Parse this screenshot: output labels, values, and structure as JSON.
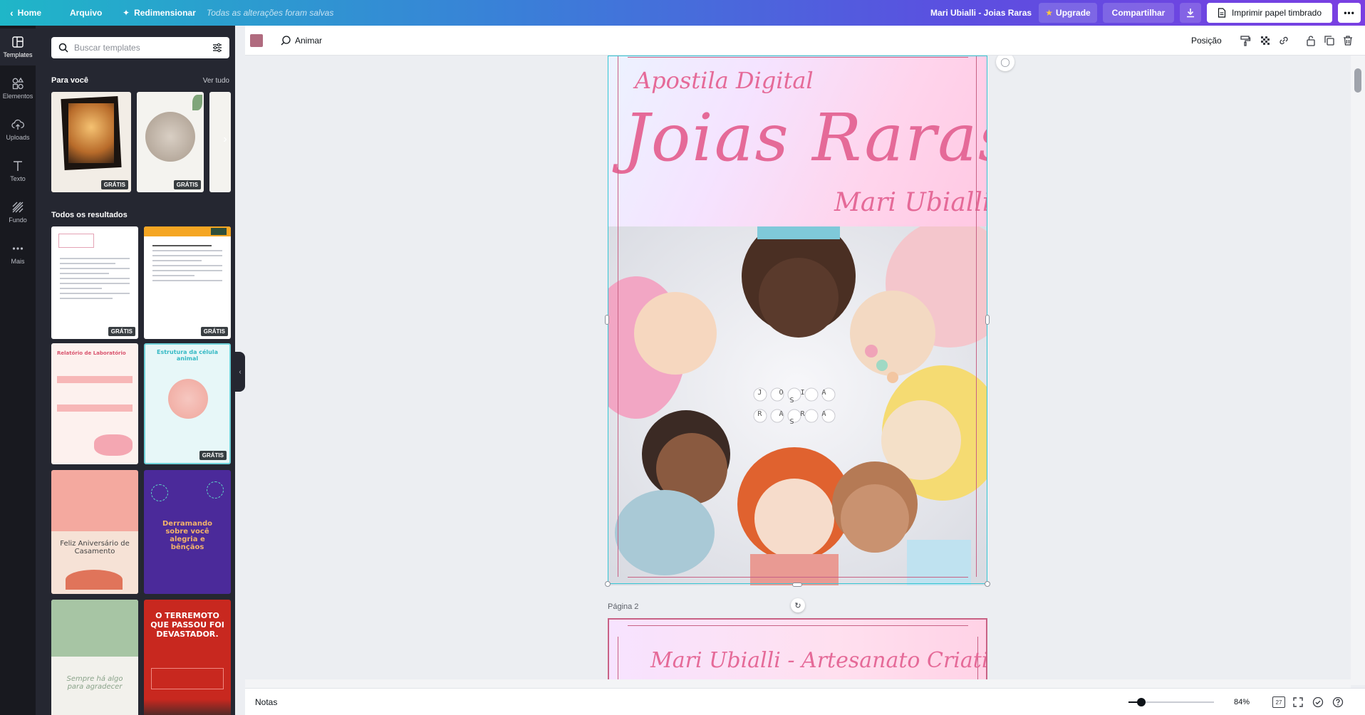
{
  "topbar": {
    "home": "Home",
    "file": "Arquivo",
    "resize": "Redimensionar",
    "saved_status": "Todas as alterações foram salvas",
    "doc_title": "Mari Ubialli - Joias Raras",
    "upgrade": "Upgrade",
    "share": "Compartilhar",
    "print": "Imprimir papel timbrado"
  },
  "rail": [
    {
      "label": "Templates",
      "icon": "templates-icon"
    },
    {
      "label": "Elementos",
      "icon": "elements-icon"
    },
    {
      "label": "Uploads",
      "icon": "upload-icon"
    },
    {
      "label": "Texto",
      "icon": "text-icon"
    },
    {
      "label": "Fundo",
      "icon": "background-icon"
    },
    {
      "label": "Mais",
      "icon": "more-icon"
    }
  ],
  "panel": {
    "search_placeholder": "Buscar templates",
    "for_you_title": "Para você",
    "see_all": "Ver tudo",
    "all_results_title": "Todos os resultados",
    "badge_free": "GRÁTIS",
    "thumbs": {
      "t3_title": "Relatório de Laboratório",
      "t4_title": "Estrutura da célula animal",
      "t5_text": "Feliz Aniversário de Casamento",
      "t6_text": "Derramando sobre você alegria e bênçãos",
      "t7_text": "Sempre há algo para agradecer",
      "t8_text": "O TERREMOTO QUE PASSOU FOI DEVASTADOR."
    }
  },
  "editor_toolbar": {
    "animate": "Animar",
    "position": "Posição",
    "swatch_color": "#b06b7f"
  },
  "canvas": {
    "page1": {
      "subtitle": "Apostila Digital",
      "title": "Joias Raras",
      "author": "Mari Ubialli",
      "beads_row1": "J O I A S",
      "beads_row2": "R A R A S"
    },
    "page2_label": "Página 2",
    "page2_title": "Mari Ubialli - Artesanato Criativo"
  },
  "bottombar": {
    "notes": "Notas",
    "zoom": "84%",
    "zoom_level": 0.84,
    "page_count": "27"
  },
  "colors": {
    "accent_pink": "#e56a98",
    "frame_pink": "#c86285",
    "selection": "#35c6d4"
  }
}
